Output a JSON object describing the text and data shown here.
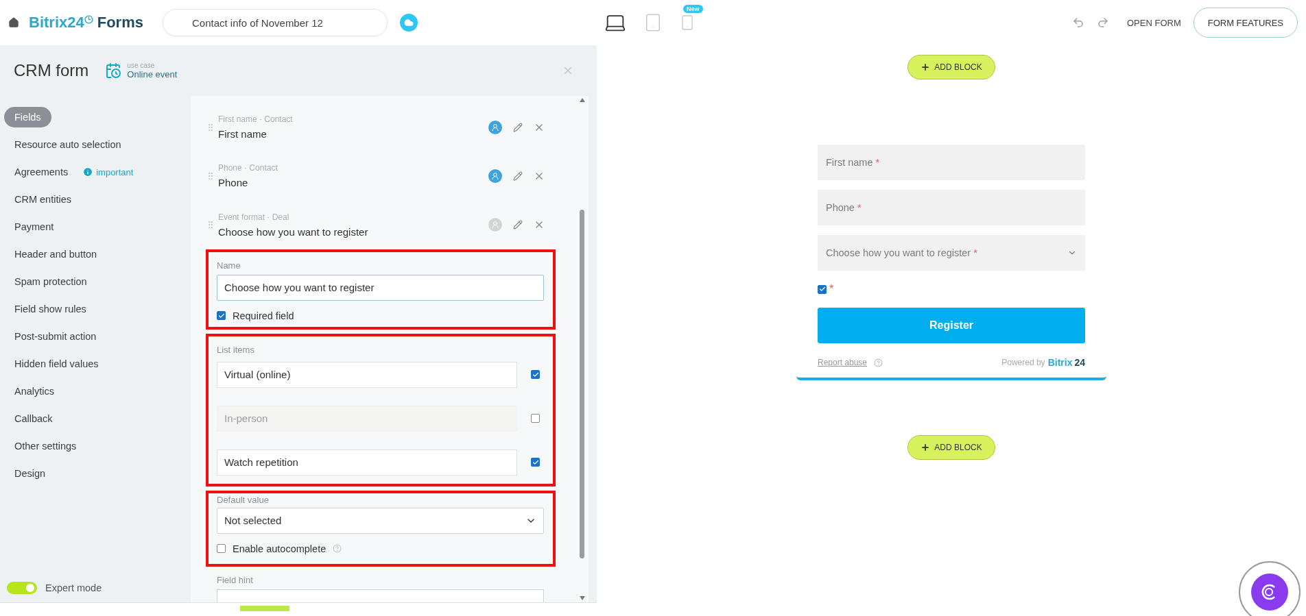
{
  "header": {
    "logo": "Bitrix24",
    "product": "Forms",
    "form_title": "Contact info of November 12",
    "devices": [
      {
        "kind": "desktop",
        "selected": true
      },
      {
        "kind": "tablet",
        "selected": false
      },
      {
        "kind": "phone",
        "selected": false,
        "badge": "New"
      }
    ],
    "open_form": "OPEN FORM",
    "form_features": "FORM FEATURES"
  },
  "panel": {
    "title": "CRM form",
    "use_case_label": "use case",
    "use_case": "Online event"
  },
  "nav": [
    {
      "label": "Fields",
      "selected": true
    },
    {
      "label": "Resource auto selection",
      "selected": false
    },
    {
      "label": "Agreements",
      "selected": false,
      "badge": "important"
    },
    {
      "label": "CRM entities",
      "selected": false
    },
    {
      "label": "Payment",
      "selected": false
    },
    {
      "label": "Header and button",
      "selected": false
    },
    {
      "label": "Spam protection",
      "selected": false
    },
    {
      "label": "Field show rules",
      "selected": false
    },
    {
      "label": "Post-submit action",
      "selected": false
    },
    {
      "label": "Hidden field values",
      "selected": false
    },
    {
      "label": "Analytics",
      "selected": false
    },
    {
      "label": "Callback",
      "selected": false
    },
    {
      "label": "Other settings",
      "selected": false
    },
    {
      "label": "Design",
      "selected": false
    }
  ],
  "expert_mode": {
    "label": "Expert mode",
    "on": true
  },
  "fields": [
    {
      "caption": "First name · Contact",
      "name": "First name",
      "linked": true
    },
    {
      "caption": "Phone · Contact",
      "name": "Phone",
      "linked": true
    },
    {
      "caption": "Event format · Deal",
      "name": "Choose how you want to register",
      "linked": false
    }
  ],
  "editor": {
    "name_label": "Name",
    "name_value": "Choose how you want to register",
    "required": {
      "label": "Required field",
      "checked": true
    },
    "list_label": "List items",
    "list_items": [
      {
        "value": "Virtual (online)",
        "checked": true
      },
      {
        "value": "In-person",
        "checked": false
      },
      {
        "value": "Watch repetition",
        "checked": true
      }
    ],
    "default_label": "Default value",
    "default_value": "Not selected",
    "autocomplete": {
      "label": "Enable autocomplete",
      "checked": false
    },
    "hint_label": "Field hint"
  },
  "preview": {
    "add_block": "ADD BLOCK",
    "fields": [
      {
        "kind": "input",
        "label": "First name",
        "mark": "*"
      },
      {
        "kind": "input",
        "label": "Phone",
        "mark": "*"
      },
      {
        "kind": "select",
        "label": "Choose how you want to register",
        "mark": "*"
      }
    ],
    "consent": {
      "checked": true,
      "mark": "*"
    },
    "submit": "Register",
    "report": "Report abuse",
    "powered": "Powered by",
    "brand": "Bitrix",
    "brand_num": "24",
    "add_block_bottom": "ADD BLOCK"
  }
}
